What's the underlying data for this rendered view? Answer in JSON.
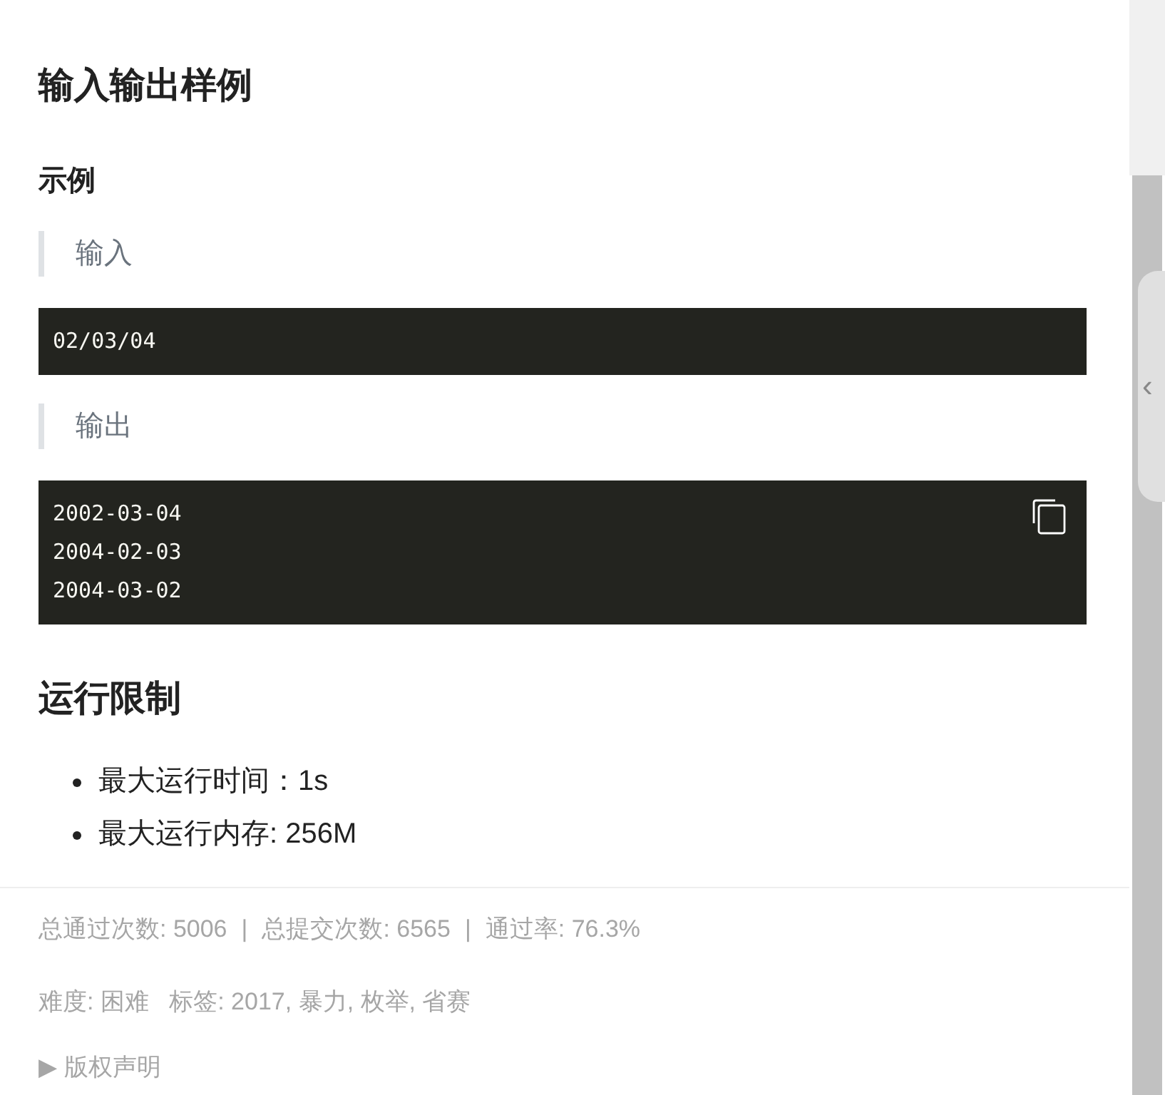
{
  "section_title": "输入输出样例",
  "example_title": "示例",
  "samples": [
    {
      "label": "输入",
      "lines": [
        "02/03/04"
      ],
      "copy": false
    },
    {
      "label": "输出",
      "lines": [
        "2002-03-04",
        "2004-02-03",
        "2004-03-02"
      ],
      "copy": true
    }
  ],
  "limits_title": "运行限制",
  "limits": [
    "最大运行时间：1s",
    "最大运行内存: 256M"
  ],
  "stats": [
    "总通过次数: 5006",
    "总提交次数: 6565",
    "通过率: 76.3%"
  ],
  "stats_separator": "|",
  "meta": "难度: 困难   标签: 2017, 暴力, 枚举, 省赛",
  "copyright": {
    "arrow": "▶",
    "label": "版权声明"
  },
  "side_tab": {
    "icon": "‹"
  }
}
